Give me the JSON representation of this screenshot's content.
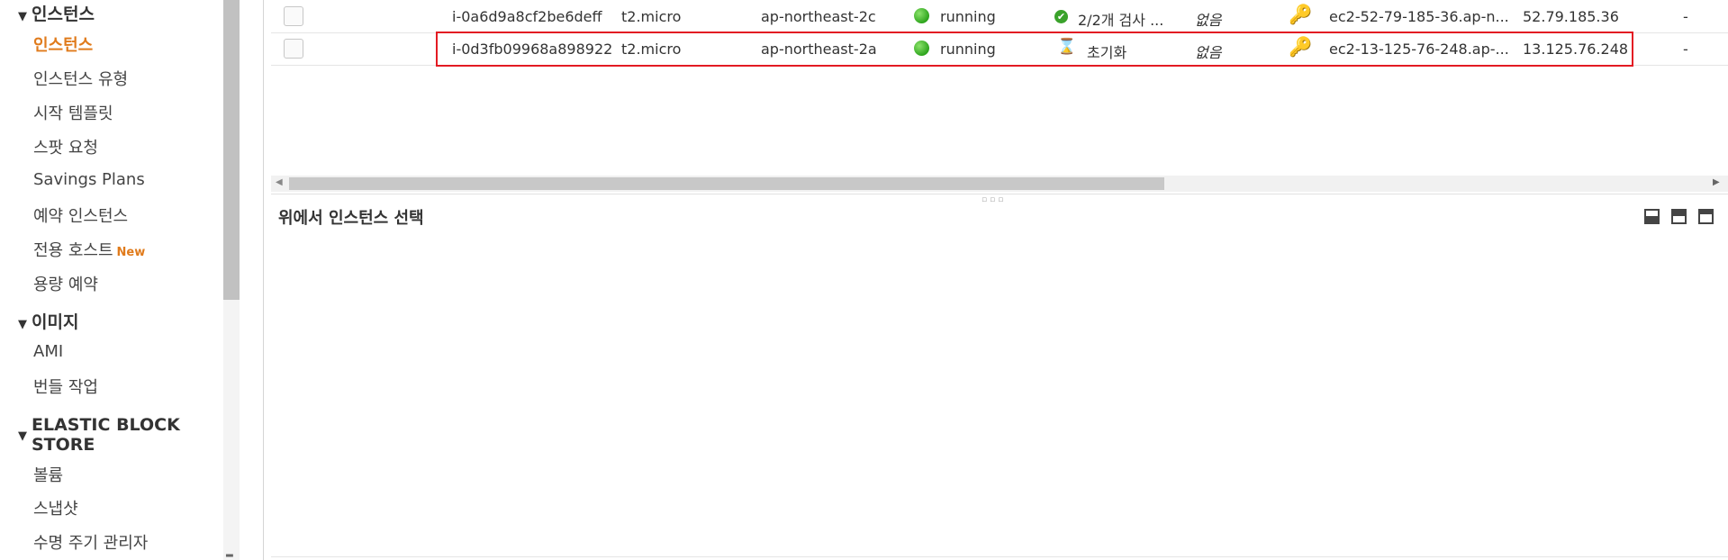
{
  "sidebar": {
    "sections": [
      {
        "title": "인스턴스",
        "items": [
          {
            "label": "인스턴스",
            "active": true
          },
          {
            "label": "인스턴스 유형"
          },
          {
            "label": "시작 템플릿"
          },
          {
            "label": "스팟 요청"
          },
          {
            "label": "Savings Plans"
          },
          {
            "label": "예약 인스턴스"
          },
          {
            "label": "전용 호스트",
            "badge": "New"
          },
          {
            "label": "용량 예약"
          }
        ]
      },
      {
        "title": "이미지",
        "items": [
          {
            "label": "AMI"
          },
          {
            "label": "번들 작업"
          }
        ]
      },
      {
        "title_line1": "ELASTIC BLOCK",
        "title_line2": "STORE",
        "items": [
          {
            "label": "볼륨"
          },
          {
            "label": "스냅샷"
          },
          {
            "label": "수명 주기 관리자"
          }
        ]
      }
    ]
  },
  "table": {
    "rows": [
      {
        "instance_id": "i-0a6d9a8cf2be6deff",
        "instance_type": "t2.micro",
        "availability_zone": "ap-northeast-2c",
        "state": "running",
        "status_check": "2/2개 검사 ...",
        "alarm": "없음",
        "public_dns": "ec2-52-79-185-36.ap-n...",
        "public_ip": "52.79.185.36",
        "extra": "-"
      },
      {
        "instance_id": "i-0d3fb09968a898922",
        "instance_type": "t2.micro",
        "availability_zone": "ap-northeast-2a",
        "state": "running",
        "status_check": "초기화",
        "alarm": "없음",
        "public_dns": "ec2-13-125-76-248.ap-...",
        "public_ip": "13.125.76.248",
        "extra": "-"
      }
    ]
  },
  "detail": {
    "title": "위에서 인스턴스 선택"
  },
  "colors": {
    "accent": "#e07b1c",
    "highlight": "#e31b23",
    "running": "#2ea51d"
  }
}
